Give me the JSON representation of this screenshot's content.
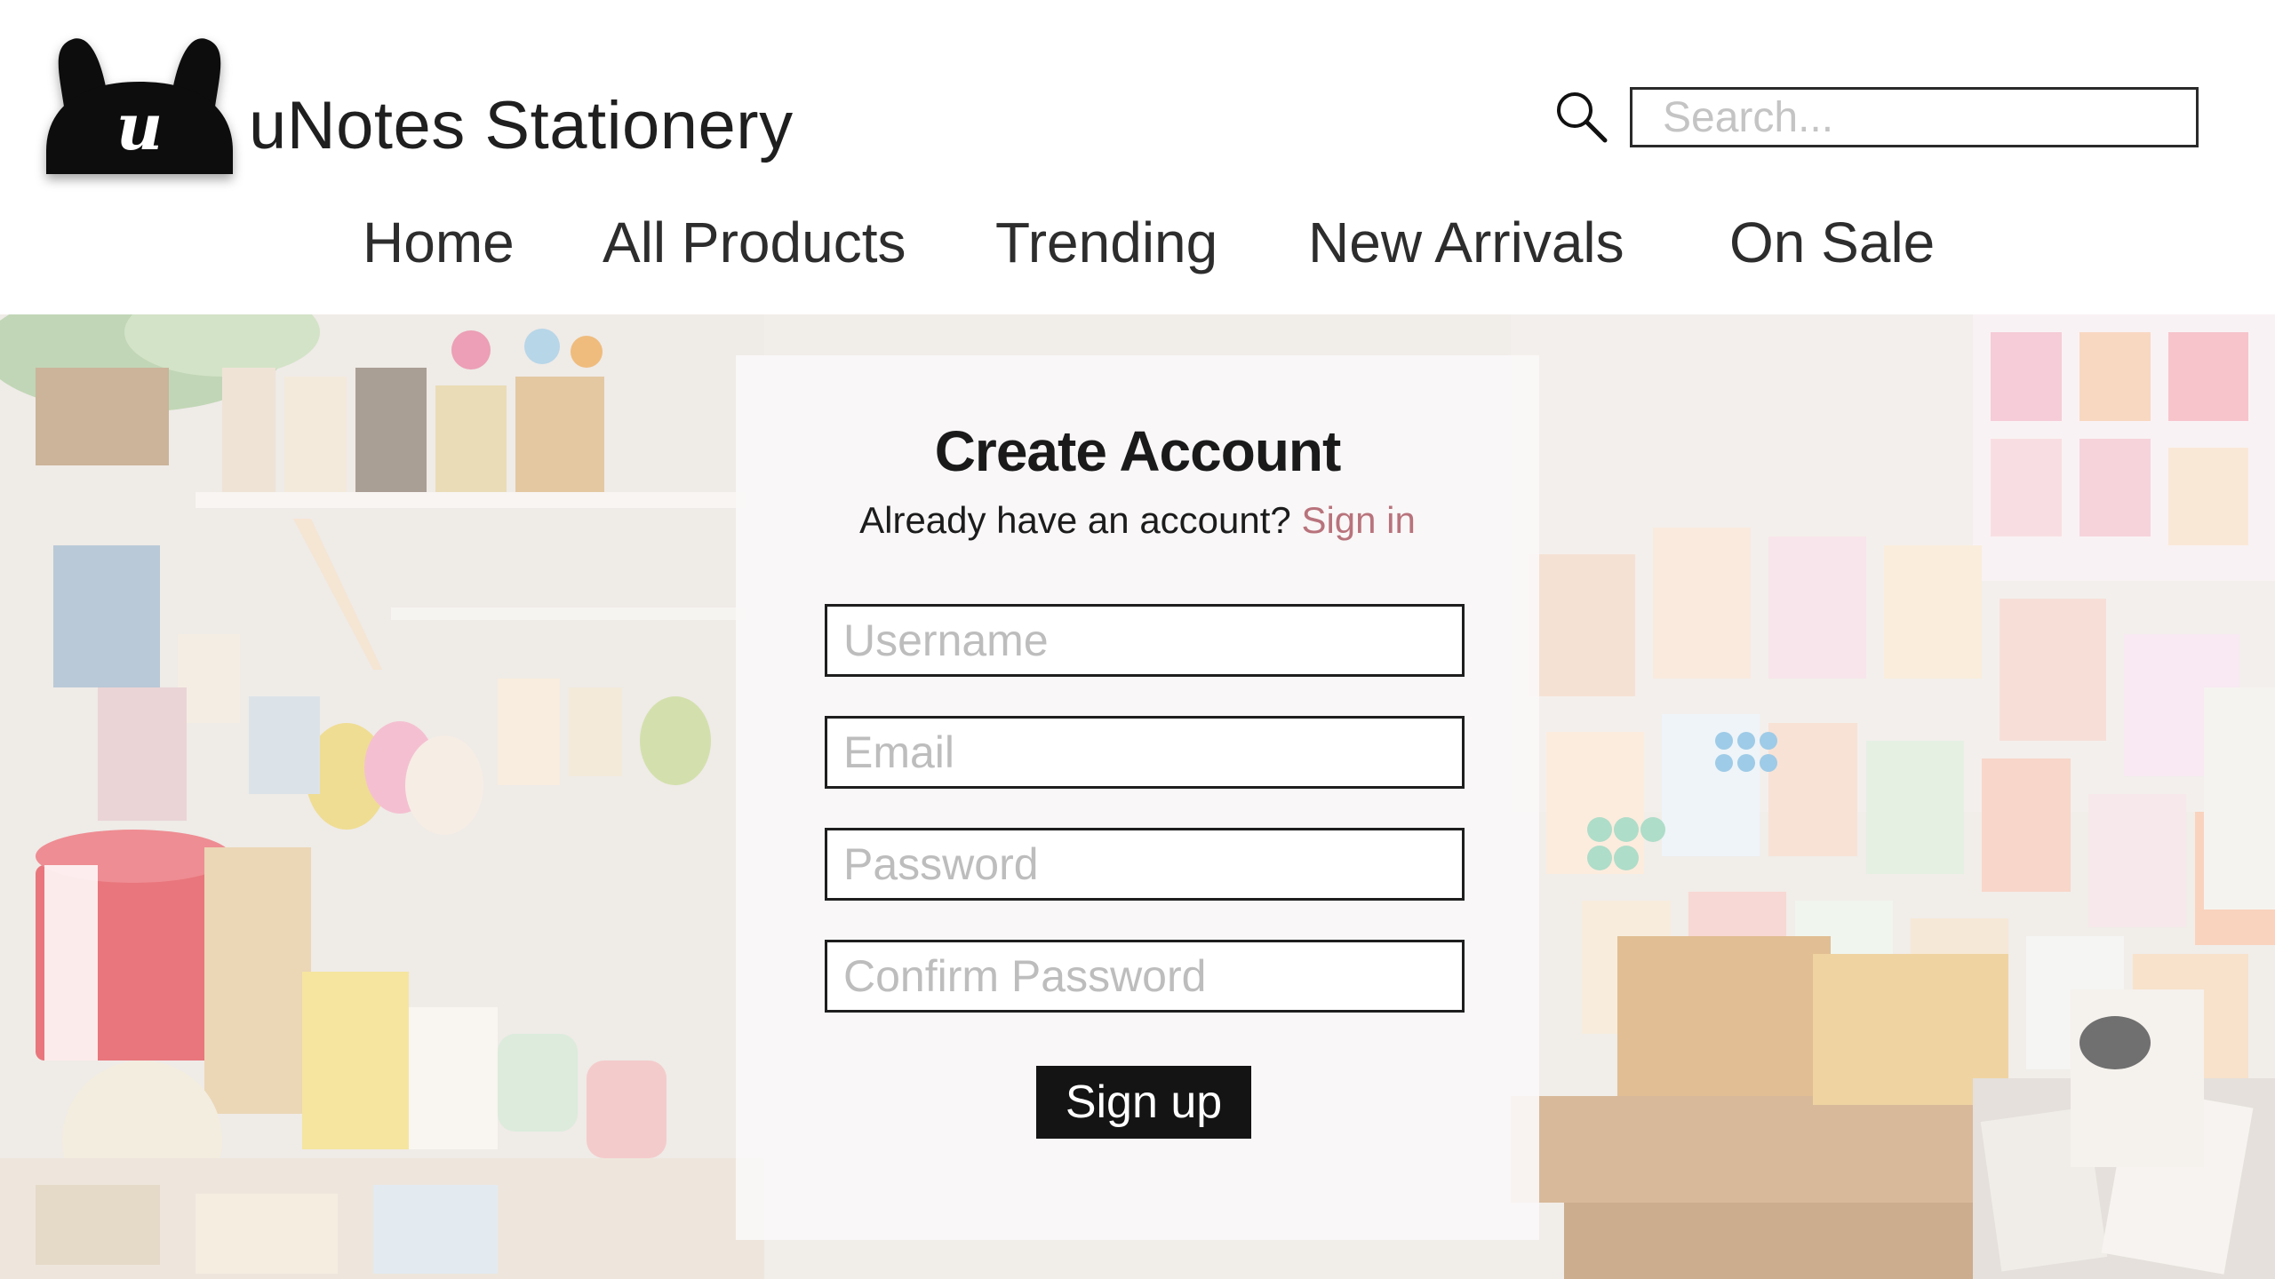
{
  "brand": {
    "logo_letter": "u",
    "name": "uNotes Stationery"
  },
  "search": {
    "placeholder": "Search..."
  },
  "nav": {
    "items": [
      {
        "label": "Home"
      },
      {
        "label": "All Products"
      },
      {
        "label": "Trending"
      },
      {
        "label": "New Arrivals"
      },
      {
        "label": "On Sale"
      }
    ]
  },
  "form": {
    "title": "Create Account",
    "prompt": "Already have an account?",
    "signin_link": "Sign in",
    "fields": {
      "username_placeholder": "Username",
      "email_placeholder": "Email",
      "password_placeholder": "Password",
      "confirm_placeholder": "Confirm Password"
    },
    "submit_label": "Sign up"
  },
  "colors": {
    "accent_link": "#b8737c",
    "button_bg": "#141414",
    "text": "#2a2a2a"
  }
}
